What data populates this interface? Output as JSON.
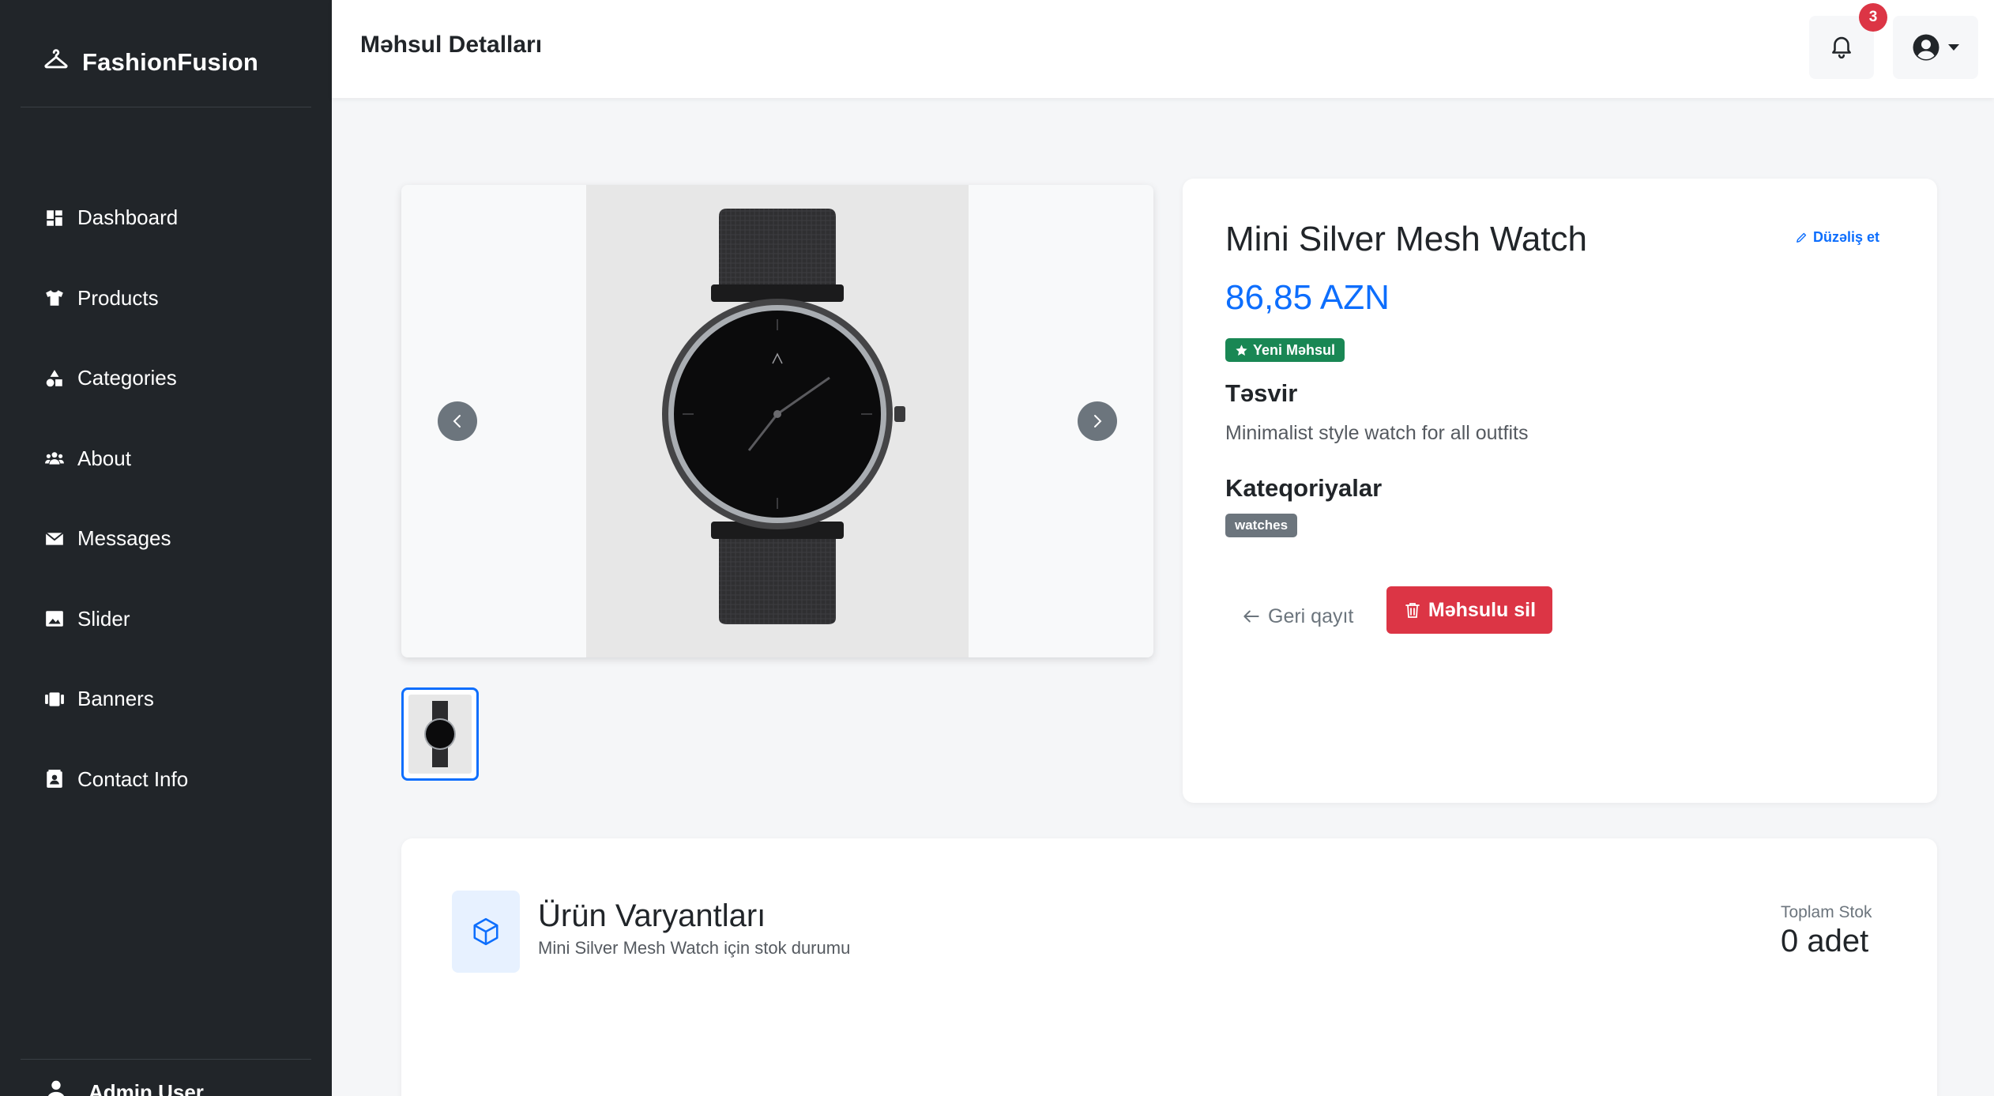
{
  "sidebar": {
    "brand": "FashionFusion",
    "items": [
      {
        "label": "Dashboard",
        "icon": "dashboard-icon"
      },
      {
        "label": "Products",
        "icon": "tshirt-icon"
      },
      {
        "label": "Categories",
        "icon": "shapes-icon"
      },
      {
        "label": "About",
        "icon": "users-icon"
      },
      {
        "label": "Messages",
        "icon": "envelope-icon"
      },
      {
        "label": "Slider",
        "icon": "image-icon"
      },
      {
        "label": "Banners",
        "icon": "banners-icon"
      },
      {
        "label": "Contact Info",
        "icon": "contact-card-icon"
      }
    ],
    "user_name": "Admin User"
  },
  "header": {
    "title": "Məhsul Detalları",
    "notification_count": "3"
  },
  "product": {
    "name": "Mini Silver Mesh Watch",
    "price": "86,85 AZN",
    "edit_label": "Düzəliş et",
    "new_badge": "Yeni Məhsul",
    "desc_heading": "Təsvir",
    "description": "Minimalist style watch for all outfits",
    "categories_heading": "Kateqoriyalar",
    "categories": [
      "watches"
    ],
    "back_label": "Geri qayıt",
    "delete_label": "Məhsulu sil"
  },
  "variants": {
    "title": "Ürün Varyantları",
    "subtitle": "Mini Silver Mesh Watch için stok durumu",
    "stock_label": "Toplam Stok",
    "stock_value": "0 adet"
  },
  "colors": {
    "sidebar_bg": "#212529",
    "primary": "#0d6efd",
    "success": "#198754",
    "danger": "#dc3545",
    "secondary": "#6c757d"
  }
}
